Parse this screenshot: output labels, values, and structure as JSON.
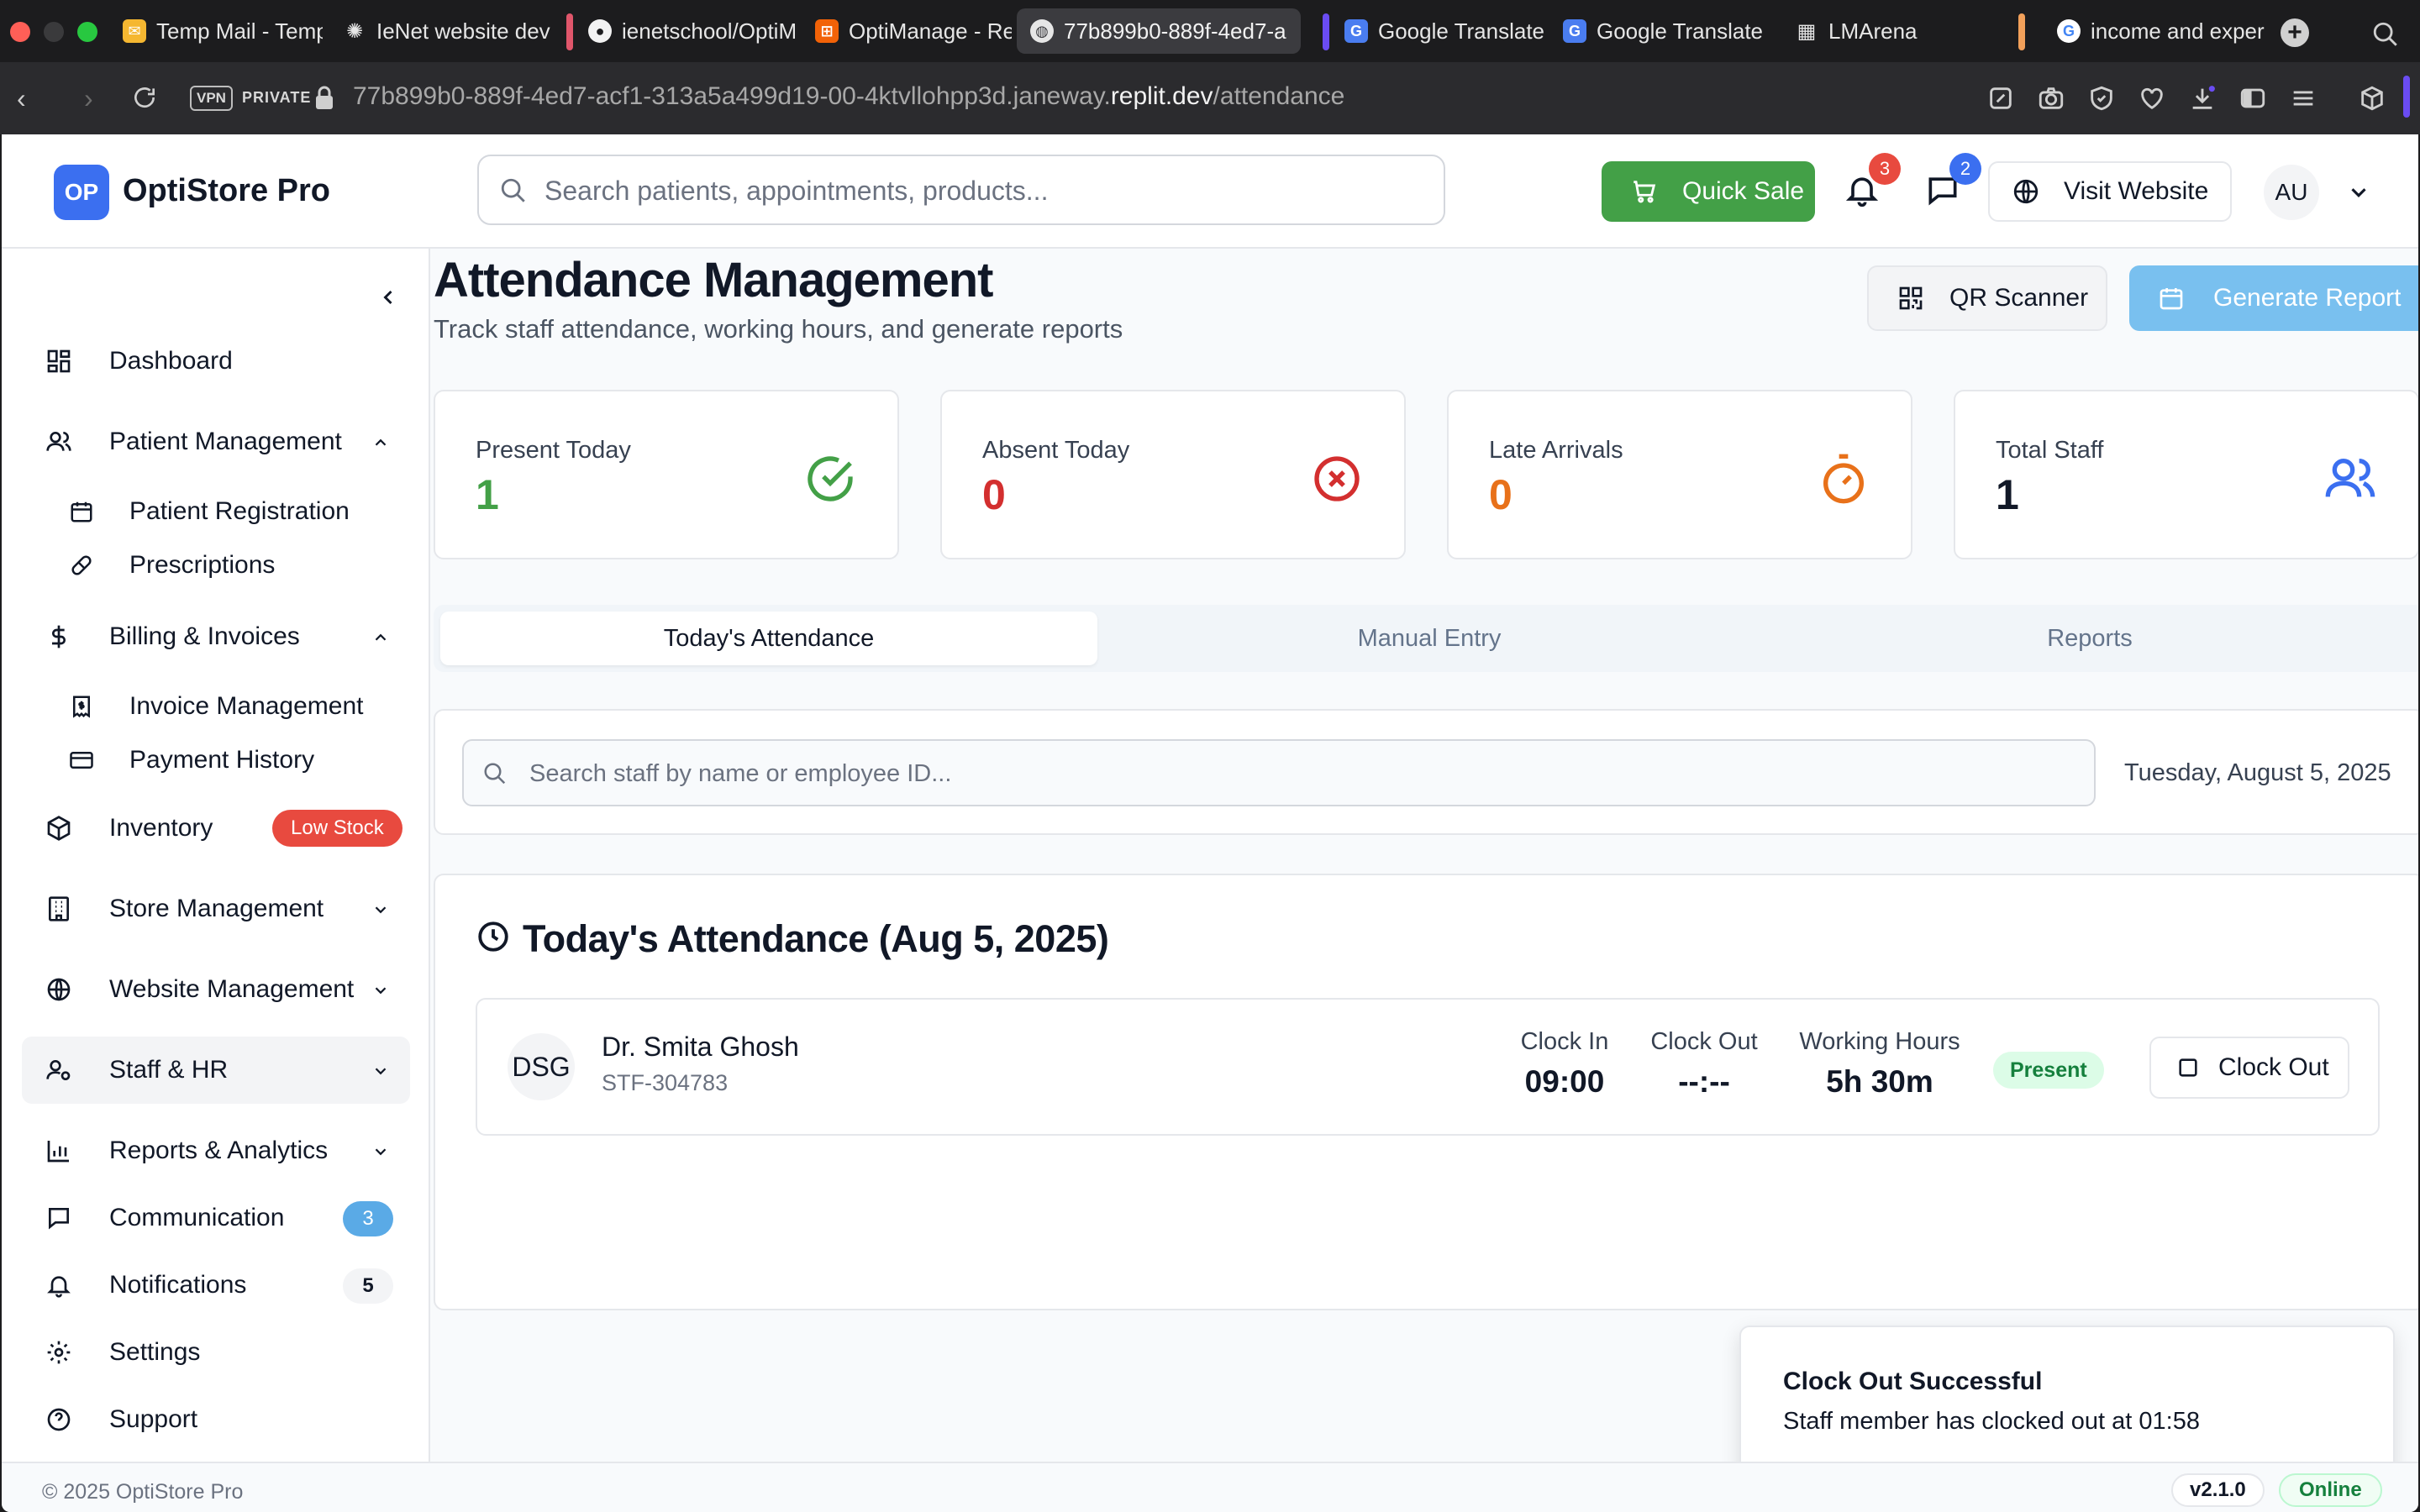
{
  "browser": {
    "tabs": [
      {
        "label": "Temp Mail - Temp",
        "icon": "mail-icon"
      },
      {
        "label": "IeNet website dev",
        "icon": "openai-icon"
      },
      {
        "label": "ienetschool/OptiM",
        "icon": "github-icon"
      },
      {
        "label": "OptiManage - Rep",
        "icon": "replit-icon"
      },
      {
        "label": "77b899b0-889f-4ed7-a",
        "icon": "globe-icon",
        "active": true
      },
      {
        "label": "Google Translate",
        "icon": "translate-icon"
      },
      {
        "label": "Google Translate",
        "icon": "translate-icon"
      },
      {
        "label": "LMArena",
        "icon": "grid-icon"
      },
      {
        "label": "income and exper",
        "icon": "google-icon"
      }
    ],
    "vpn_label": "VPN",
    "private_label": "PRIVATE",
    "url_prefix": "77b899b0-889f-4ed7-acf1-313a5a499d19-00-4ktvllohpp3d.janeway.",
    "url_domain": "replit.dev",
    "url_path": "/attendance"
  },
  "header": {
    "logo_initials": "OP",
    "brand": "OptiStore Pro",
    "search_placeholder": "Search patients, appointments, products...",
    "quick_sale_label": "Quick Sale",
    "notifications_count": "3",
    "messages_count": "2",
    "visit_website_label": "Visit Website",
    "user_initials": "AU"
  },
  "sidebar": {
    "items": [
      {
        "label": "Dashboard",
        "icon": "dashboard-icon"
      },
      {
        "label": "Patient Management",
        "icon": "users-icon",
        "expanded": true
      },
      {
        "label": "Patient Registration",
        "icon": "calendar-icon",
        "sub": true
      },
      {
        "label": "Prescriptions",
        "icon": "pill-icon",
        "sub": true
      },
      {
        "label": "Billing & Invoices",
        "icon": "dollar-icon",
        "expanded": true
      },
      {
        "label": "Invoice Management",
        "icon": "receipt-icon",
        "sub": true
      },
      {
        "label": "Payment History",
        "icon": "credit-card-icon",
        "sub": true
      },
      {
        "label": "Inventory",
        "icon": "package-icon",
        "badge": "Low Stock"
      },
      {
        "label": "Store Management",
        "icon": "building-icon"
      },
      {
        "label": "Website Management",
        "icon": "globe-icon"
      },
      {
        "label": "Staff & HR",
        "icon": "user-cog-icon",
        "active": true
      },
      {
        "label": "Reports & Analytics",
        "icon": "bar-chart-icon"
      },
      {
        "label": "Communication",
        "icon": "message-icon",
        "badge": "3"
      },
      {
        "label": "Notifications",
        "icon": "bell-icon",
        "badge": "5"
      },
      {
        "label": "Settings",
        "icon": "gear-icon"
      },
      {
        "label": "Support",
        "icon": "help-icon"
      }
    ]
  },
  "page": {
    "title": "Attendance Management",
    "subtitle": "Track staff attendance, working hours, and generate reports",
    "qr_label": "QR Scanner",
    "report_label": "Generate Report"
  },
  "stats": [
    {
      "label": "Present Today",
      "value": "1",
      "color": "#43a047",
      "icon": "check-circle-icon"
    },
    {
      "label": "Absent Today",
      "value": "0",
      "color": "#d32f2f",
      "icon": "x-circle-icon"
    },
    {
      "label": "Late Arrivals",
      "value": "0",
      "color": "#e8711a",
      "icon": "timer-icon"
    },
    {
      "label": "Total Staff",
      "value": "1",
      "color": "#111827",
      "icon": "users-icon"
    }
  ],
  "tabs": [
    "Today's Attendance",
    "Manual Entry",
    "Reports"
  ],
  "filter": {
    "search_placeholder": "Search staff by name or employee ID...",
    "date": "Tuesday, August 5, 2025"
  },
  "attendance": {
    "title": "Today's Attendance (Aug 5, 2025)",
    "rows": [
      {
        "initials": "DSG",
        "name": "Dr. Smita Ghosh",
        "employee_id": "STF-304783",
        "clock_in_label": "Clock In",
        "clock_in": "09:00",
        "clock_out_label": "Clock Out",
        "clock_out": "--:--",
        "hours_label": "Working Hours",
        "hours": "5h 30m",
        "status": "Present",
        "action": "Clock Out"
      }
    ]
  },
  "toast": {
    "title": "Clock Out Successful",
    "description": "Staff member has clocked out at 01:58"
  },
  "footer": {
    "copyright": "© 2025 OptiStore Pro",
    "version": "v2.1.0",
    "status": "Online"
  },
  "colors": {
    "primary": "#3b6ff0",
    "success": "#43a047",
    "danger": "#e84a3f",
    "info": "#79c0ef"
  }
}
